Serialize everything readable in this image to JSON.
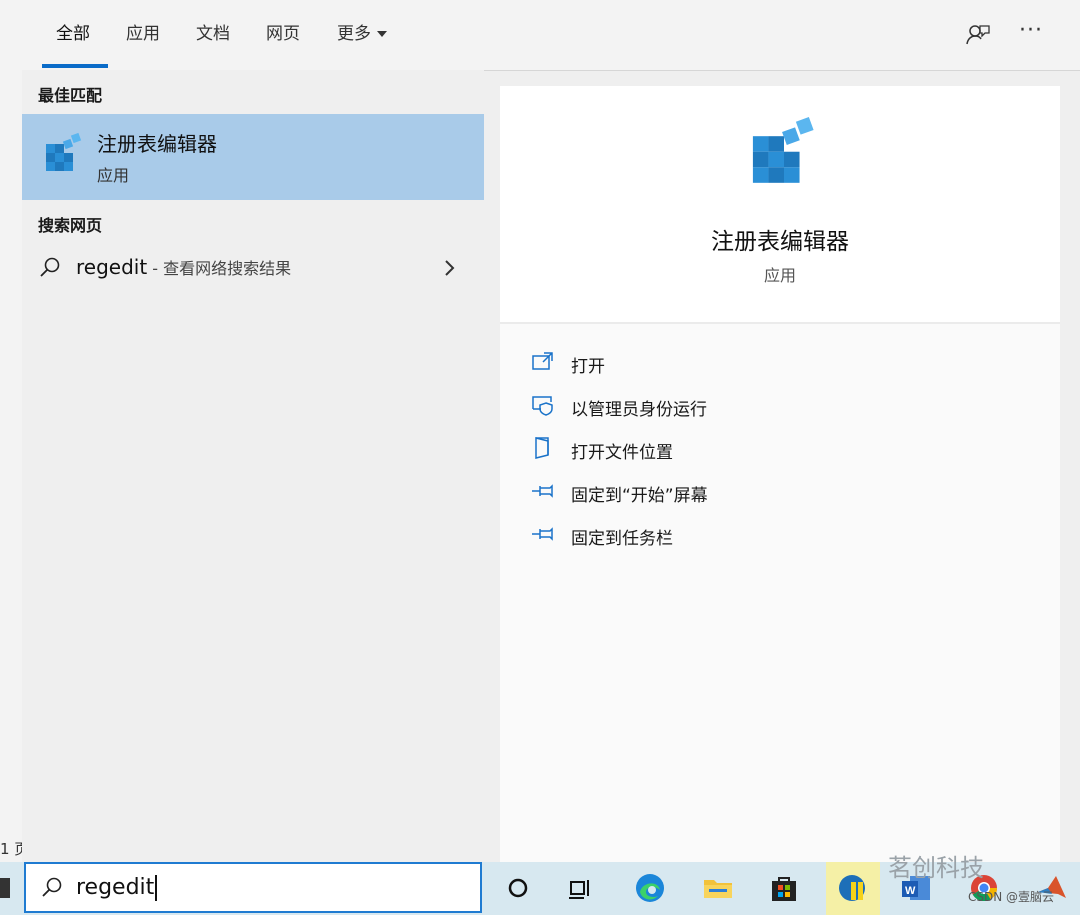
{
  "background": {
    "fragment": "1 页"
  },
  "tabs": [
    {
      "label": "全部"
    },
    {
      "label": "应用"
    },
    {
      "label": "文档"
    },
    {
      "label": "网页"
    },
    {
      "label": "更多"
    }
  ],
  "toolbar": {
    "feedback_icon": "feedback-icon",
    "more_icon": "ellipsis-icon",
    "more_label": "···"
  },
  "left": {
    "best_match_title": "最佳匹配",
    "best_match": {
      "title": "注册表编辑器",
      "subtitle": "应用",
      "icon": "registry-editor-icon"
    },
    "web_title": "搜索网页",
    "web_item": {
      "query": "regedit",
      "desc": " - 查看网络搜索结果",
      "icon": "search-icon"
    }
  },
  "right": {
    "app_title": "注册表编辑器",
    "app_subtitle": "应用",
    "actions": [
      {
        "label": "打开",
        "icon": "open-icon"
      },
      {
        "label": "以管理员身份运行",
        "icon": "run-as-admin-icon"
      },
      {
        "label": "打开文件位置",
        "icon": "file-location-icon"
      },
      {
        "label": "固定到“开始”屏幕",
        "icon": "pin-icon"
      },
      {
        "label": "固定到任务栏",
        "icon": "pin-icon"
      }
    ]
  },
  "taskbar": {
    "search_value": "regedit",
    "apps": [
      "cortana-icon",
      "task-view-icon",
      "edge-icon",
      "file-explorer-icon",
      "store-icon",
      "app-icon",
      "word-icon",
      "chrome-icon",
      "matlab-icon"
    ]
  },
  "watermark": {
    "text": "茗创科技",
    "sub": "CSDN @壹脑云"
  },
  "colors": {
    "accent": "#0a6bc8",
    "selected": "#a9cbe9",
    "taskbar": "#d7e8f0"
  }
}
